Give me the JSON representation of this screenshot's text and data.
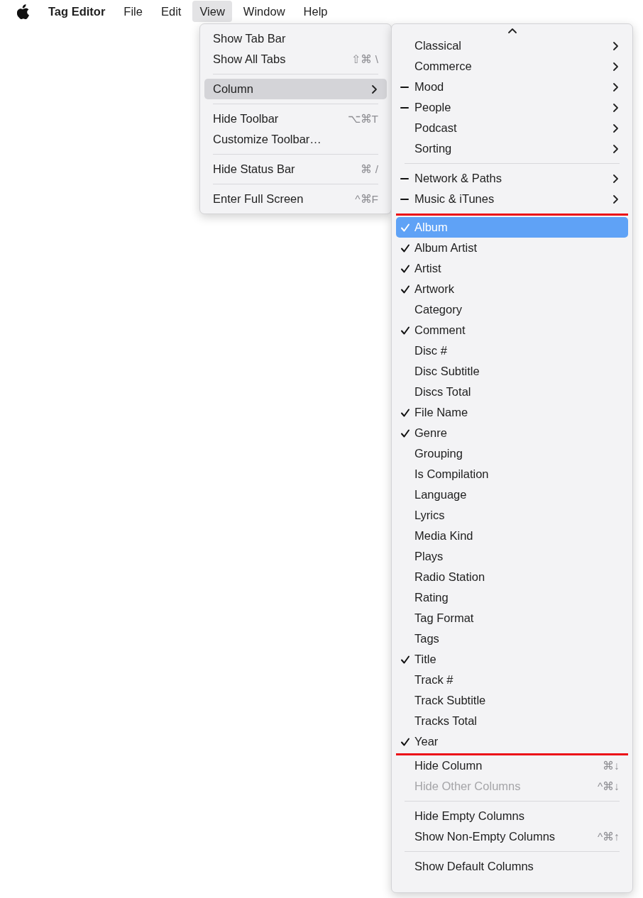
{
  "menu_bar": {
    "app_name": "Tag Editor",
    "menus": [
      {
        "label": "File",
        "selected": false
      },
      {
        "label": "Edit",
        "selected": false
      },
      {
        "label": "View",
        "selected": true
      },
      {
        "label": "Window",
        "selected": false
      },
      {
        "label": "Help",
        "selected": false
      }
    ]
  },
  "view_menu": {
    "items": [
      {
        "kind": "item",
        "label": "Show Tab Bar",
        "selected": false
      },
      {
        "kind": "item",
        "label": "Show All Tabs",
        "shortcut": "⇧⌘ \\",
        "selected": false
      },
      {
        "kind": "separator"
      },
      {
        "kind": "item",
        "label": "Column",
        "submenu": true,
        "selected": true
      },
      {
        "kind": "separator"
      },
      {
        "kind": "item",
        "label": "Hide Toolbar",
        "shortcut": "⌥⌘T",
        "selected": false
      },
      {
        "kind": "item",
        "label": "Customize Toolbar…",
        "selected": false
      },
      {
        "kind": "separator"
      },
      {
        "kind": "item",
        "label": "Hide Status Bar",
        "shortcut": "⌘ /",
        "selected": false
      },
      {
        "kind": "separator"
      },
      {
        "kind": "item",
        "label": "Enter Full Screen",
        "shortcut": "^⌘F",
        "selected": false
      }
    ]
  },
  "column_menu": {
    "sections": [
      {
        "outlined": false,
        "items": [
          {
            "kind": "item",
            "label": "Classical",
            "checked": false,
            "mixed": false,
            "submenu": true,
            "selected": false
          },
          {
            "kind": "item",
            "label": "Commerce",
            "checked": false,
            "mixed": false,
            "submenu": true,
            "selected": false
          },
          {
            "kind": "item",
            "label": "Mood",
            "checked": false,
            "mixed": true,
            "submenu": true,
            "selected": false
          },
          {
            "kind": "item",
            "label": "People",
            "checked": false,
            "mixed": true,
            "submenu": true,
            "selected": false
          },
          {
            "kind": "item",
            "label": "Podcast",
            "checked": false,
            "mixed": false,
            "submenu": true,
            "selected": false
          },
          {
            "kind": "item",
            "label": "Sorting",
            "checked": false,
            "mixed": false,
            "submenu": true,
            "selected": false
          },
          {
            "kind": "separator"
          },
          {
            "kind": "item",
            "label": "Network & Paths",
            "checked": false,
            "mixed": true,
            "submenu": true,
            "selected": false
          },
          {
            "kind": "item",
            "label": "Music & iTunes",
            "checked": false,
            "mixed": true,
            "submenu": true,
            "selected": false
          }
        ]
      },
      {
        "outlined": true,
        "items": [
          {
            "kind": "item",
            "label": "Album",
            "checked": true,
            "selected": true
          },
          {
            "kind": "item",
            "label": "Album Artist",
            "checked": true,
            "selected": false
          },
          {
            "kind": "item",
            "label": "Artist",
            "checked": true,
            "selected": false
          },
          {
            "kind": "item",
            "label": "Artwork",
            "checked": true,
            "selected": false
          },
          {
            "kind": "item",
            "label": "Category",
            "checked": false,
            "selected": false
          },
          {
            "kind": "item",
            "label": "Comment",
            "checked": true,
            "selected": false
          },
          {
            "kind": "item",
            "label": "Disc #",
            "checked": false,
            "selected": false
          },
          {
            "kind": "item",
            "label": "Disc Subtitle",
            "checked": false,
            "selected": false
          },
          {
            "kind": "item",
            "label": "Discs Total",
            "checked": false,
            "selected": false
          },
          {
            "kind": "item",
            "label": "File Name",
            "checked": true,
            "selected": false
          },
          {
            "kind": "item",
            "label": "Genre",
            "checked": true,
            "selected": false
          },
          {
            "kind": "item",
            "label": "Grouping",
            "checked": false,
            "selected": false
          },
          {
            "kind": "item",
            "label": "Is Compilation",
            "checked": false,
            "selected": false
          },
          {
            "kind": "item",
            "label": "Language",
            "checked": false,
            "selected": false
          },
          {
            "kind": "item",
            "label": "Lyrics",
            "checked": false,
            "selected": false
          },
          {
            "kind": "item",
            "label": "Media Kind",
            "checked": false,
            "selected": false
          },
          {
            "kind": "item",
            "label": "Plays",
            "checked": false,
            "selected": false
          },
          {
            "kind": "item",
            "label": "Radio Station",
            "checked": false,
            "selected": false
          },
          {
            "kind": "item",
            "label": "Rating",
            "checked": false,
            "selected": false
          },
          {
            "kind": "item",
            "label": "Tag Format",
            "checked": false,
            "selected": false
          },
          {
            "kind": "item",
            "label": "Tags",
            "checked": false,
            "selected": false
          },
          {
            "kind": "item",
            "label": "Title",
            "checked": true,
            "selected": false
          },
          {
            "kind": "item",
            "label": "Track #",
            "checked": false,
            "selected": false
          },
          {
            "kind": "item",
            "label": "Track Subtitle",
            "checked": false,
            "selected": false
          },
          {
            "kind": "item",
            "label": "Tracks Total",
            "checked": false,
            "selected": false
          },
          {
            "kind": "item",
            "label": "Year",
            "checked": true,
            "selected": false
          }
        ]
      },
      {
        "outlined": false,
        "items": [
          {
            "kind": "item",
            "label": "Hide Column",
            "shortcut": "⌘↓",
            "disabled": false,
            "selected": false
          },
          {
            "kind": "item",
            "label": "Hide Other Columns",
            "shortcut": "^⌘↓",
            "disabled": true,
            "selected": false
          },
          {
            "kind": "separator"
          },
          {
            "kind": "item",
            "label": "Hide Empty Columns",
            "disabled": false,
            "selected": false
          },
          {
            "kind": "item",
            "label": "Show Non-Empty Columns",
            "shortcut": "^⌘↑",
            "disabled": false,
            "selected": false
          },
          {
            "kind": "separator"
          },
          {
            "kind": "item",
            "label": "Show Default Columns",
            "disabled": false,
            "selected": false
          }
        ]
      }
    ]
  }
}
